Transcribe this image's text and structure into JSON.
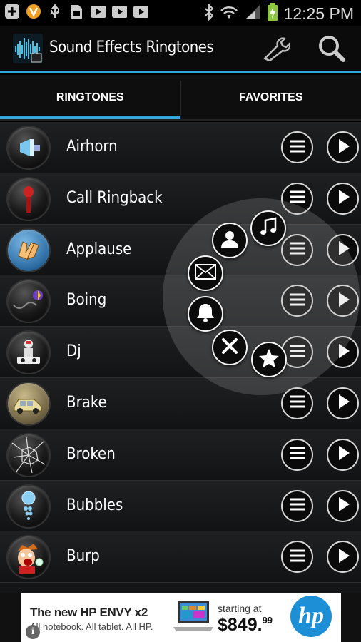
{
  "status_bar": {
    "time": "12:25 PM",
    "icons": [
      "add-icon",
      "v-app-icon",
      "usb-icon",
      "sim-icon",
      "youtube-icon",
      "youtube-icon",
      "youtube-icon",
      "bluetooth-icon",
      "wifi-icon",
      "signal-icon",
      "battery-charging-icon"
    ]
  },
  "action_bar": {
    "title": "Sound Effects Ringtones",
    "settings_icon": "wrench-icon",
    "search_icon": "search-icon"
  },
  "tabs": [
    {
      "label": "RINGTONES",
      "selected": true
    },
    {
      "label": "FAVORITES",
      "selected": false
    }
  ],
  "list": {
    "items": [
      {
        "label": "Airhorn",
        "icon": "airhorn-icon"
      },
      {
        "label": "Call Ringback",
        "icon": "microphone-icon"
      },
      {
        "label": "Applause",
        "icon": "clapping-hands-icon"
      },
      {
        "label": "Boing",
        "icon": "spring-icon"
      },
      {
        "label": "Dj",
        "icon": "dj-icon"
      },
      {
        "label": "Brake",
        "icon": "car-icon"
      },
      {
        "label": "Broken",
        "icon": "broken-glass-icon"
      },
      {
        "label": "Bubbles",
        "icon": "bubbles-icon"
      },
      {
        "label": "Burp",
        "icon": "burp-icon"
      }
    ]
  },
  "radial_menu": {
    "items": [
      "contact-icon",
      "music-note-icon",
      "mail-icon",
      "bell-icon",
      "close-icon",
      "star-icon"
    ]
  },
  "ad": {
    "headline": "The new HP ENVY x2",
    "sub": "All notebook. All tablet. All HP.",
    "starting": "starting at",
    "price": "$849.",
    "cents": "99",
    "brand": "hp",
    "info": "i",
    "colors": {
      "brand": "#1d8fd6"
    }
  },
  "colors": {
    "accent": "#31a8de"
  }
}
